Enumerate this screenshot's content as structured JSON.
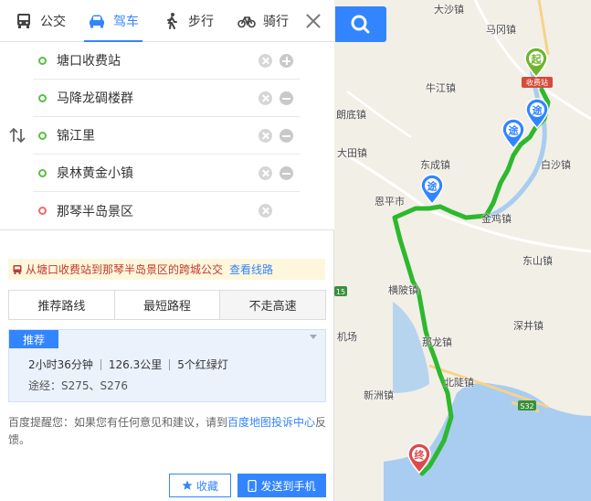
{
  "modes": {
    "bus": "公交",
    "drive": "驾车",
    "walk": "步行",
    "bike": "骑行"
  },
  "waypoints": [
    {
      "name": "塘口收费站",
      "type": "start"
    },
    {
      "name": "马降龙碉楼群",
      "type": "via"
    },
    {
      "name": "锦江里",
      "type": "via"
    },
    {
      "name": "泉林黄金小镇",
      "type": "via"
    },
    {
      "name": "那琴半岛景区",
      "type": "end"
    }
  ],
  "bus_tip": {
    "text": "从塘口收费站到那琴半岛景区的跨城公交",
    "link": "查看线路"
  },
  "route_tabs": [
    "推荐路线",
    "最短路程",
    "不走高速"
  ],
  "result": {
    "badge": "推荐",
    "time": "2小时36分钟",
    "distance": "126.3公里",
    "lights": "5个红绿灯",
    "via": "途经：S275、S276"
  },
  "feedback": {
    "prefix": "百度提醒您：如果您有任何意见和建议，请到",
    "link": "百度地图投诉中心",
    "suffix": "反馈。"
  },
  "buttons": {
    "favorite": "收藏",
    "send": "发送到手机"
  },
  "map": {
    "markers": {
      "start": "起",
      "via": "途",
      "end": "终",
      "toll": "收费站"
    },
    "labels": {
      "dasha": "大沙镇",
      "magang": "马冈镇",
      "niujiang": "牛江镇",
      "langdi": "朗底镇",
      "datian": "大田镇",
      "dongcheng": "东成镇",
      "baisha": "白沙镇",
      "enping": "恩平市",
      "jinji": "金鸡镇",
      "dongshan": "东山镇",
      "hengpo": "横陂镇",
      "shenjing": "深井镇",
      "airport": "机场",
      "nalong": "那龙镇",
      "beidou": "北陡镇",
      "xinzhou": "新洲镇",
      "road_s32": "S32",
      "road_15": "15"
    }
  }
}
